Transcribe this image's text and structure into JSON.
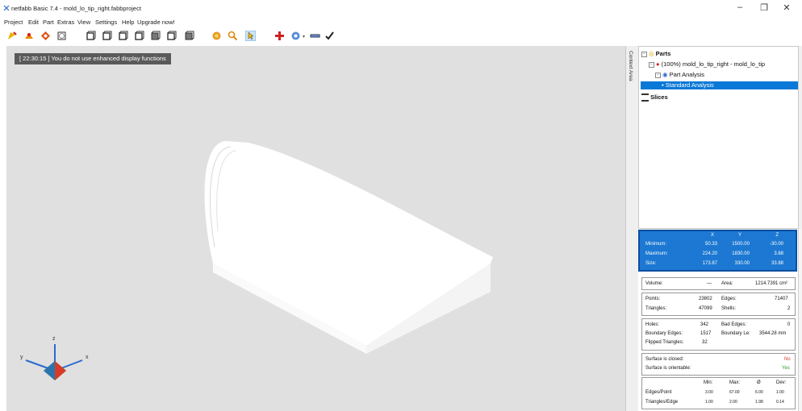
{
  "window": {
    "title": "netfabb Basic 7.4 - mold_lo_tip_right.fabbproject",
    "minimize": "–",
    "restore": "❐",
    "close": "✕"
  },
  "menu": [
    "Project",
    "Edit",
    "Part",
    "Extras",
    "View",
    "Settings",
    "Help",
    "Upgrade now!"
  ],
  "toolbar_icons": [
    "new-project-icon",
    "open-part-icon",
    "repair-icon",
    "export-icon",
    "view-front-icon",
    "view-back-icon",
    "view-left-icon",
    "view-right-icon",
    "view-top-icon",
    "view-bottom-icon",
    "zoom-all-icon",
    "zoom-icon",
    "select-cursor-icon",
    "add-icon",
    "measure-icon",
    "cut-icon",
    "check-icon"
  ],
  "viewport": {
    "status_message": "[ 22:30:15 ] You do not use enhanced display functions",
    "axes": {
      "x": "x",
      "y": "y",
      "z": "z"
    }
  },
  "context_strip": {
    "label": "Context Area"
  },
  "tree": {
    "parts": "Parts",
    "part_item": "(100%) mold_lo_tip_right - mold_lo_tip",
    "part_analysis": "Part Analysis",
    "standard_analysis": "Standard Analysis",
    "slices": "Slices"
  },
  "stats": {
    "headers": [
      "X",
      "Y",
      "Z"
    ],
    "rows": [
      {
        "label": "Minimum:",
        "x": "50.33",
        "y": "1500.00",
        "z": "-30.00"
      },
      {
        "label": "Maximum:",
        "x": "224.20",
        "y": "1830.00",
        "z": "3.88"
      },
      {
        "label": "Size:",
        "x": "173.87",
        "y": "330.00",
        "z": "33.88"
      }
    ],
    "volume_label": "Volume:",
    "volume_value": "—",
    "area_label": "Area:",
    "area_value": "1214.7391 cm²",
    "points_label": "Points:",
    "points_value": "23802",
    "edges_label": "Edges:",
    "edges_value": "71407",
    "triangles_label": "Triangles:",
    "triangles_value": "47099",
    "shells_label": "Shells:",
    "shells_value": "2",
    "holes_label": "Holes:",
    "holes_value": "342",
    "bad_edges_label": "Bad Edges:",
    "bad_edges_value": "0",
    "boundary_edges_label": "Boundary Edges:",
    "boundary_edges_value": "1517",
    "boundary_length_label": "Boundary Le:",
    "boundary_length_value": "3544.28 mm",
    "flipped_label": "Flipped Triangles:",
    "flipped_value": "32",
    "closed_label": "Surface is closed:",
    "closed_value": "No",
    "orientable_label": "Surface is orientable:",
    "orientable_value": "Yes",
    "table_headers": [
      "Min:",
      "Max:",
      "Ø",
      "Dev:"
    ],
    "table_rows": [
      {
        "label": "Edges/Point",
        "min": "3.00",
        "max": "67.00",
        "avg": "6.00",
        "dev": "1.00"
      },
      {
        "label": "Triangles/Edge",
        "min": "1.00",
        "max": "2.00",
        "avg": "1.98",
        "dev": "0.14"
      }
    ]
  },
  "colors": {
    "selection": "#0a78d7",
    "stat_header": "#1c78d2",
    "viewport_bg": "#e0e0e0",
    "no_color": "#d83a2a",
    "yes_color": "#2a9a2a"
  }
}
